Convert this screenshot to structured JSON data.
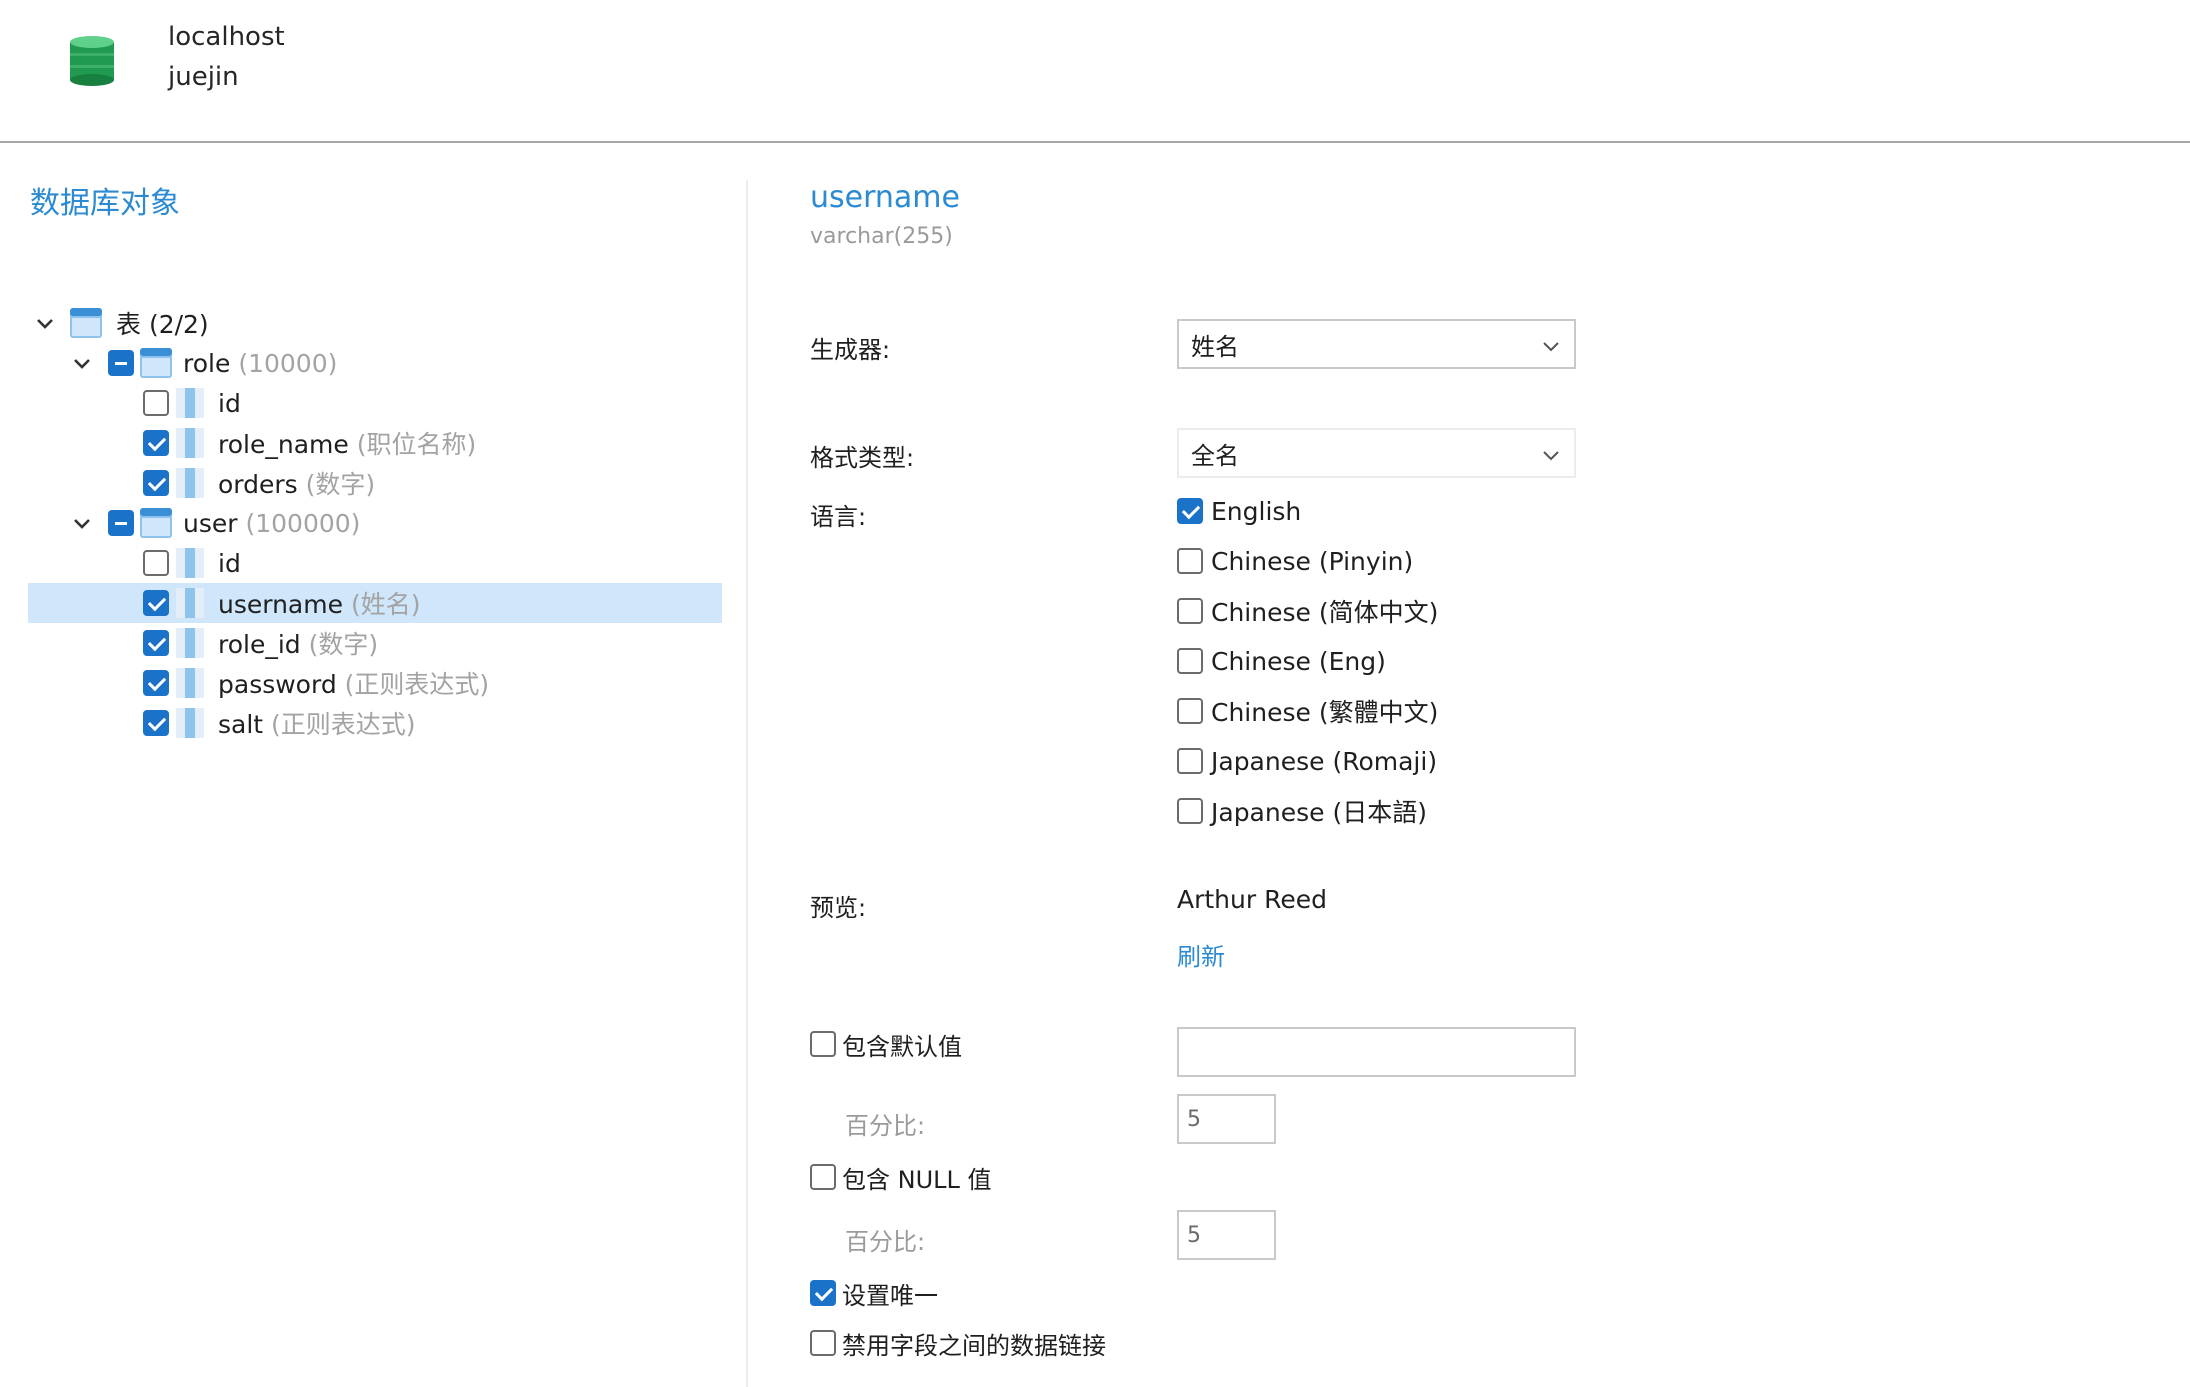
{
  "connection": {
    "host": "localhost",
    "database": "juejin"
  },
  "left": {
    "title": "数据库对象",
    "tree": {
      "root": {
        "label": "表 (2/2)"
      },
      "tables": [
        {
          "name": "role",
          "count": "(10000)",
          "columns": [
            {
              "name": "id",
              "hint": "",
              "checked": false
            },
            {
              "name": "role_name",
              "hint": "(职位名称)",
              "checked": true
            },
            {
              "name": "orders",
              "hint": "(数字)",
              "checked": true
            }
          ]
        },
        {
          "name": "user",
          "count": "(100000)",
          "columns": [
            {
              "name": "id",
              "hint": "",
              "checked": false
            },
            {
              "name": "username",
              "hint": "(姓名)",
              "checked": true,
              "selected": true
            },
            {
              "name": "role_id",
              "hint": "(数字)",
              "checked": true
            },
            {
              "name": "password",
              "hint": "(正则表达式)",
              "checked": true
            },
            {
              "name": "salt",
              "hint": "(正则表达式)",
              "checked": true
            }
          ]
        }
      ]
    }
  },
  "right": {
    "field_name": "username",
    "field_type": "varchar(255)",
    "generator": {
      "label": "生成器:",
      "value": "姓名"
    },
    "format": {
      "label": "格式类型:",
      "value": "全名"
    },
    "language": {
      "label": "语言:",
      "options": [
        {
          "label": "English",
          "checked": true
        },
        {
          "label": "Chinese (Pinyin)",
          "checked": false
        },
        {
          "label": "Chinese (简体中文)",
          "checked": false
        },
        {
          "label": "Chinese (Eng)",
          "checked": false
        },
        {
          "label": "Chinese (繁體中文)",
          "checked": false
        },
        {
          "label": "Japanese (Romaji)",
          "checked": false
        },
        {
          "label": "Japanese (日本語)",
          "checked": false
        }
      ]
    },
    "preview": {
      "label": "预览:",
      "value": "Arthur Reed",
      "refresh": "刷新"
    },
    "default_value": {
      "label": "包含默认值",
      "checked": false,
      "value": "",
      "percent_label": "百分比:",
      "percent": "5"
    },
    "null_value": {
      "label": "包含 NULL 值",
      "checked": false,
      "percent_label": "百分比:",
      "percent": "5"
    },
    "unique": {
      "label": "设置唯一",
      "checked": true
    },
    "disable_link": {
      "label": "禁用字段之间的数据链接",
      "checked": false
    }
  },
  "colors": {
    "accent": "#2b8ad1",
    "checkbox": "#1a73c9",
    "selected_row": "#cfe6fb",
    "db_icon": "#1f9a4f"
  }
}
